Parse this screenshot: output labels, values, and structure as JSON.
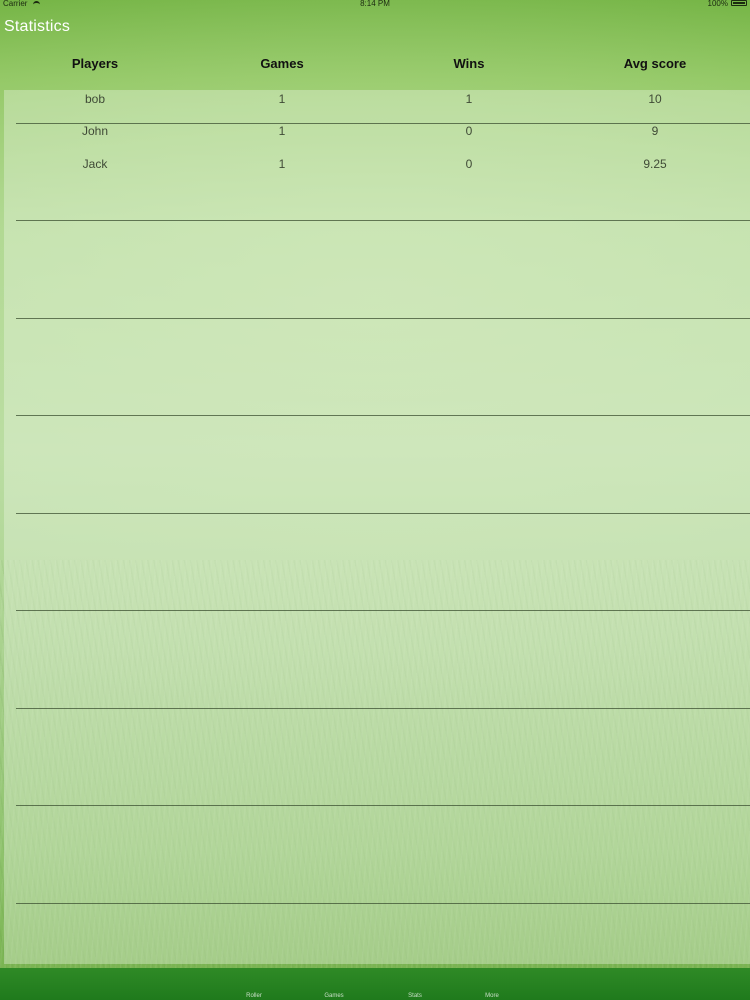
{
  "status_bar": {
    "carrier": "Carrier",
    "time": "8:14 PM",
    "battery": "100%"
  },
  "nav": {
    "title": "Statistics"
  },
  "table": {
    "columns": [
      "Players",
      "Games",
      "Wins",
      "Avg score"
    ],
    "rows": [
      [
        "bob",
        "1",
        "1",
        "10"
      ],
      [
        "John",
        "1",
        "0",
        "9"
      ],
      [
        "Jack",
        "1",
        "0",
        "9.25"
      ]
    ]
  },
  "tab_bar": {
    "items": [
      "Roller",
      "Games",
      "Stats",
      "More"
    ]
  },
  "colors": {
    "tab_bar": "#1f7a1c",
    "title_text": "#ffffff"
  }
}
